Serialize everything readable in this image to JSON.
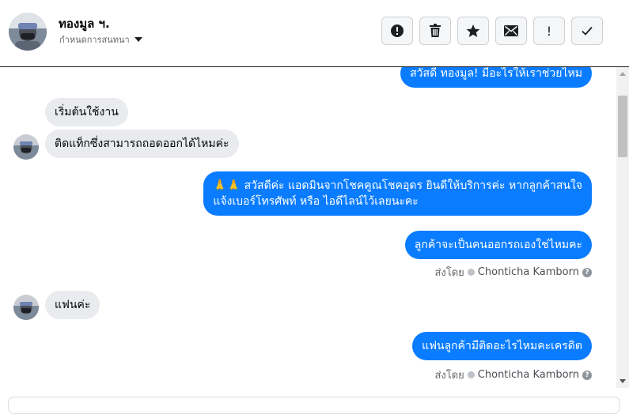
{
  "header": {
    "name": "ทองมูล ฯ.",
    "subtitle": "กำหนดการสนทนา"
  },
  "actions": [
    {
      "name": "report",
      "icon": "alert-circle-icon"
    },
    {
      "name": "delete",
      "icon": "trash-icon"
    },
    {
      "name": "star",
      "icon": "star-icon"
    },
    {
      "name": "mail",
      "icon": "envelope-icon"
    },
    {
      "name": "important",
      "icon": "exclamation-icon",
      "glyph": "!"
    },
    {
      "name": "done",
      "icon": "checkmark-icon"
    }
  ],
  "messages": [
    {
      "id": "m1",
      "dir": "out",
      "text": "สวัสดี ทองมูล! มีอะไรให้เราช่วยไหม"
    },
    {
      "id": "m2",
      "dir": "in",
      "text": "เริ่มต้นใช้งาน"
    },
    {
      "id": "m3",
      "dir": "in",
      "text": "ติดแท็กซึ่งสามารถถอดออกได้ไหมค่ะ"
    },
    {
      "id": "m4",
      "dir": "out",
      "lines": [
        "🙏🙏 สวัสดีค่ะ แอดมินจากโชคคูณโชคอุดร ยินดีให้บริการค่ะ หากลูกค้าสนใจ",
        "แจ้งเบอร์โทรศัพท์ หรือ ไอดีไลน์ไว้เลยนะคะ"
      ]
    },
    {
      "id": "m5",
      "dir": "out",
      "text": "ลูกค้าจะเป็นคนออกรถเองใช่ไหมคะ"
    },
    {
      "id": "m6",
      "dir": "in",
      "text": "แฟนค่ะ"
    },
    {
      "id": "m7",
      "dir": "out",
      "text": "แฟนลูกค้ามีติดอะไรไหมคะเครดิต"
    }
  ],
  "sent_by": {
    "prefix": "ส่งโดย",
    "agent": "Chonticha Kamborn",
    "help": "?"
  }
}
